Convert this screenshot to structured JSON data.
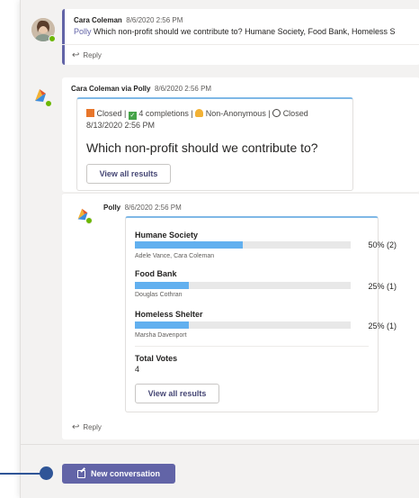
{
  "message1": {
    "author": "Cara Coleman",
    "timestamp": "8/6/2020 2:56 PM",
    "mention": "Polly",
    "text": " Which non-profit should we contribute to? Humane Society, Food Bank, Homeless S",
    "reply_label": "Reply"
  },
  "message2": {
    "header": "Cara Coleman via Polly",
    "timestamp": "8/6/2020 2:56 PM",
    "status_line1": "Closed | ",
    "completions": "4 completions",
    "status_line2": " | ",
    "anonymity": "Non-Anonymous",
    "closed_prefix": " | ",
    "closed_label": "Closed",
    "closed_date": "8/13/2020 2:56 PM",
    "question": "Which non-profit should we contribute to?",
    "view_results_label": "View all results"
  },
  "reply_thread": {
    "author": "Polly",
    "timestamp": "8/6/2020 2:56 PM",
    "options": [
      {
        "label": "Humane Society",
        "percent_text": "50% (2)",
        "fraction": 0.5,
        "voters": "Adele Vance, Cara Coleman"
      },
      {
        "label": "Food Bank",
        "percent_text": "25% (1)",
        "fraction": 0.25,
        "voters": "Douglas Cothran"
      },
      {
        "label": "Homeless Shelter",
        "percent_text": "25% (1)",
        "fraction": 0.25,
        "voters": "Marsha Davenport"
      }
    ],
    "total_votes_label": "Total Votes",
    "total_votes": "4",
    "view_results_label": "View all results",
    "reply_label": "Reply"
  },
  "footer": {
    "new_conversation_label": "New conversation"
  },
  "colors": {
    "accent": "#6264a7",
    "bar": "#62b0ef",
    "presence": "#6bb700",
    "pointer": "#2f5597"
  }
}
